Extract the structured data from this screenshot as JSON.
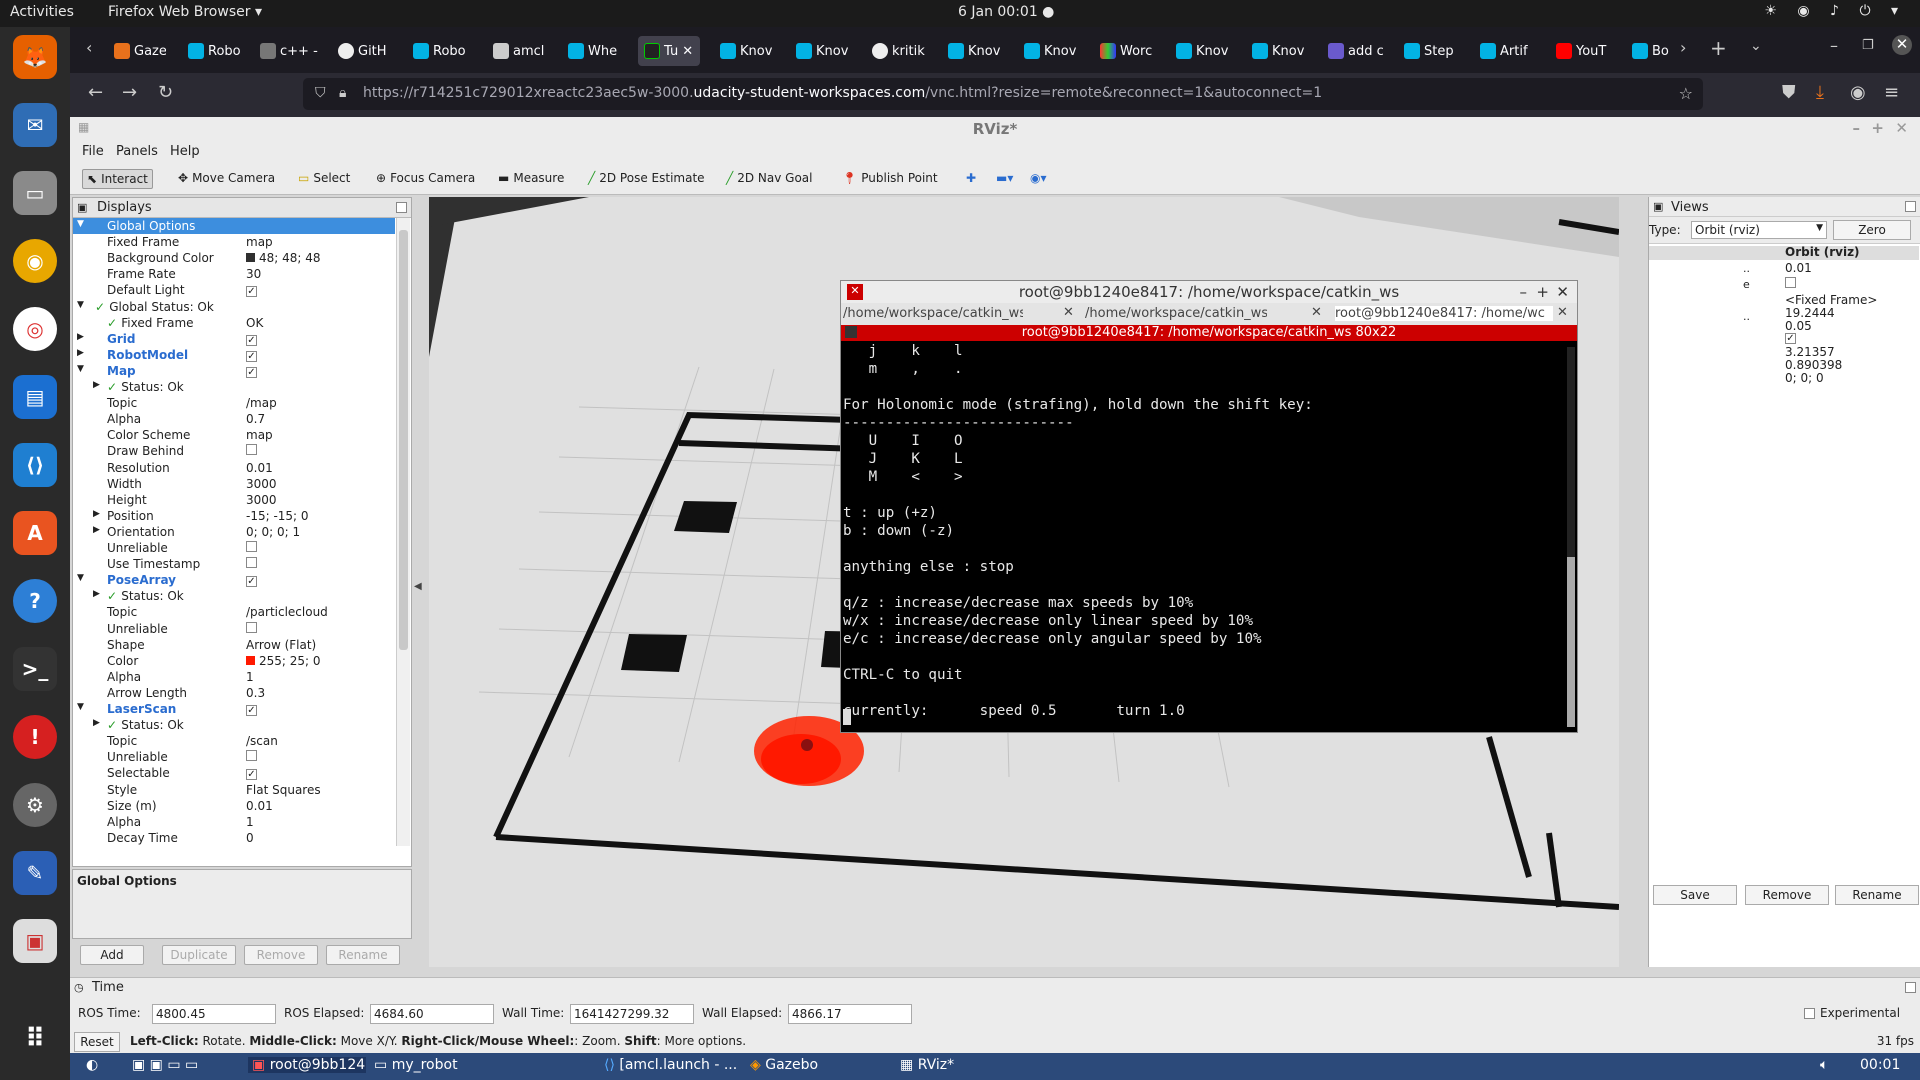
{
  "topbar": {
    "activities": "Activities",
    "app_menu": "Firefox Web Browser ▾",
    "clock": "6 Jan  00:01  ●"
  },
  "browser": {
    "tabs": [
      "Gaze",
      "Robo",
      "c++ -",
      "GitH",
      "Robo",
      "amcl",
      "Whe",
      "Tu",
      "Knov",
      "Knov",
      "kritik",
      "Knov",
      "Knov",
      "Worc",
      "Knov",
      "Knov",
      "add c",
      "Step",
      "Artif",
      "YouT",
      "Bo"
    ],
    "url_prefix": "https://r714251c729012xreactc23aec5w-3000.",
    "url_domain": "udacity-student-workspaces.com",
    "url_suffix": "/vnc.html?resize=remote&reconnect=1&autoconnect=1"
  },
  "rviz": {
    "title": "RViz*",
    "menus": [
      "File",
      "Panels",
      "Help"
    ],
    "tools": [
      "Interact",
      "Move Camera",
      "Select",
      "Focus Camera",
      "Measure",
      "2D Pose Estimate",
      "2D Nav Goal",
      "Publish Point"
    ],
    "displays_title": "Displays",
    "rows": [
      {
        "k": "Global Options",
        "v": "",
        "ind": 1,
        "sel": true
      },
      {
        "k": "Fixed Frame",
        "v": "map",
        "ind": 2
      },
      {
        "k": "Background Color",
        "v": "48; 48; 48",
        "ind": 2,
        "sw": "#303030"
      },
      {
        "k": "Frame Rate",
        "v": "30",
        "ind": 2
      },
      {
        "k": "Default Light",
        "v": "",
        "ind": 2,
        "cb": true
      },
      {
        "k": "Global Status: Ok",
        "v": "",
        "ind": 1,
        "ok": true
      },
      {
        "k": "Fixed Frame",
        "v": "OK",
        "ind": 2,
        "ok": true
      },
      {
        "k": "Grid",
        "v": "",
        "ind": 1,
        "blue": true,
        "cb": true
      },
      {
        "k": "RobotModel",
        "v": "",
        "ind": 1,
        "blue": true,
        "cb": true
      },
      {
        "k": "Map",
        "v": "",
        "ind": 1,
        "blue": true,
        "cb": true
      },
      {
        "k": "Status: Ok",
        "v": "",
        "ind": 2,
        "ok": true
      },
      {
        "k": "Topic",
        "v": "/map",
        "ind": 2
      },
      {
        "k": "Alpha",
        "v": "0.7",
        "ind": 2
      },
      {
        "k": "Color Scheme",
        "v": "map",
        "ind": 2
      },
      {
        "k": "Draw Behind",
        "v": "",
        "ind": 2,
        "cbe": true
      },
      {
        "k": "Resolution",
        "v": "0.01",
        "ind": 2
      },
      {
        "k": "Width",
        "v": "3000",
        "ind": 2
      },
      {
        "k": "Height",
        "v": "3000",
        "ind": 2
      },
      {
        "k": "Position",
        "v": "-15; -15; 0",
        "ind": 2
      },
      {
        "k": "Orientation",
        "v": "0; 0; 0; 1",
        "ind": 2
      },
      {
        "k": "Unreliable",
        "v": "",
        "ind": 2,
        "cbe": true
      },
      {
        "k": "Use Timestamp",
        "v": "",
        "ind": 2,
        "cbe": true
      },
      {
        "k": "PoseArray",
        "v": "",
        "ind": 1,
        "blue": true,
        "cb": true
      },
      {
        "k": "Status: Ok",
        "v": "",
        "ind": 2,
        "ok": true
      },
      {
        "k": "Topic",
        "v": "/particlecloud",
        "ind": 2
      },
      {
        "k": "Unreliable",
        "v": "",
        "ind": 2,
        "cbe": true
      },
      {
        "k": "Shape",
        "v": "Arrow (Flat)",
        "ind": 2
      },
      {
        "k": "Color",
        "v": "255; 25; 0",
        "ind": 2,
        "sw": "#ff1900"
      },
      {
        "k": "Alpha",
        "v": "1",
        "ind": 2
      },
      {
        "k": "Arrow Length",
        "v": "0.3",
        "ind": 2
      },
      {
        "k": "LaserScan",
        "v": "",
        "ind": 1,
        "blue": true,
        "cb": true
      },
      {
        "k": "Status: Ok",
        "v": "",
        "ind": 2,
        "ok": true
      },
      {
        "k": "Topic",
        "v": "/scan",
        "ind": 2
      },
      {
        "k": "Unreliable",
        "v": "",
        "ind": 2,
        "cbe": true
      },
      {
        "k": "Selectable",
        "v": "",
        "ind": 2,
        "cb": true
      },
      {
        "k": "Style",
        "v": "Flat Squares",
        "ind": 2
      },
      {
        "k": "Size (m)",
        "v": "0.01",
        "ind": 2
      },
      {
        "k": "Alpha",
        "v": "1",
        "ind": 2
      },
      {
        "k": "Decay Time",
        "v": "0",
        "ind": 2
      }
    ],
    "desc_title": "Global Options",
    "panel_buttons": [
      "Add",
      "Duplicate",
      "Remove",
      "Rename"
    ],
    "views": {
      "title": "Views",
      "type_label": "Type:",
      "type_value": "Orbit (rviz)",
      "zero": "Zero",
      "header": "Orbit (rviz)",
      "values": [
        "0.01",
        "",
        "<Fixed Frame>",
        "19.2444",
        "0.05",
        "",
        "3.21357",
        "0.890398",
        "0; 0; 0"
      ],
      "buttons": [
        "Save",
        "Remove",
        "Rename"
      ]
    },
    "time": {
      "title": "Time",
      "ros_time_label": "ROS Time:",
      "ros_time": "4800.45",
      "ros_elapsed_label": "ROS Elapsed:",
      "ros_elapsed": "4684.60",
      "wall_time_label": "Wall Time:",
      "wall_time": "1641427299.32",
      "wall_elapsed_label": "Wall Elapsed:",
      "wall_elapsed": "4866.17",
      "experimental": "Experimental"
    },
    "status": {
      "reset": "Reset",
      "hint_b1": "Left-Click:",
      "hint_t1": " Rotate. ",
      "hint_b2": "Middle-Click:",
      "hint_t2": " Move X/Y. ",
      "hint_b3": "Right-Click/Mouse Wheel:",
      "hint_t3": ": Zoom. ",
      "hint_b4": "Shift",
      "hint_t4": ": More options.",
      "fps": "31 fps"
    }
  },
  "terminal": {
    "title": "root@9bb1240e8417: /home/workspace/catkin_ws",
    "tabs": [
      "/home/workspace/catkin_ws/sr",
      "/home/workspace/catkin_ws/sr",
      "root@9bb1240e8417: /home/wc"
    ],
    "bar": "root@9bb1240e8417: /home/workspace/catkin_ws 80x22",
    "lines": [
      "   j    k    l",
      "   m    ,    .",
      "",
      "For Holonomic mode (strafing), hold down the shift key:",
      "---------------------------",
      "   U    I    O",
      "   J    K    L",
      "   M    <    >",
      "",
      "t : up (+z)",
      "b : down (-z)",
      "",
      "anything else : stop",
      "",
      "q/z : increase/decrease max speeds by 10%",
      "w/x : increase/decrease only linear speed by 10%",
      "e/c : increase/decrease only angular speed by 10%",
      "",
      "CTRL-C to quit",
      "",
      "currently:      speed 0.5       turn 1.0"
    ]
  },
  "taskbar": {
    "items": [
      "root@9bb1240...",
      "my_robot",
      "[amcl.launch - ...",
      "Gazebo",
      "RViz*"
    ],
    "clock": "00:01"
  }
}
